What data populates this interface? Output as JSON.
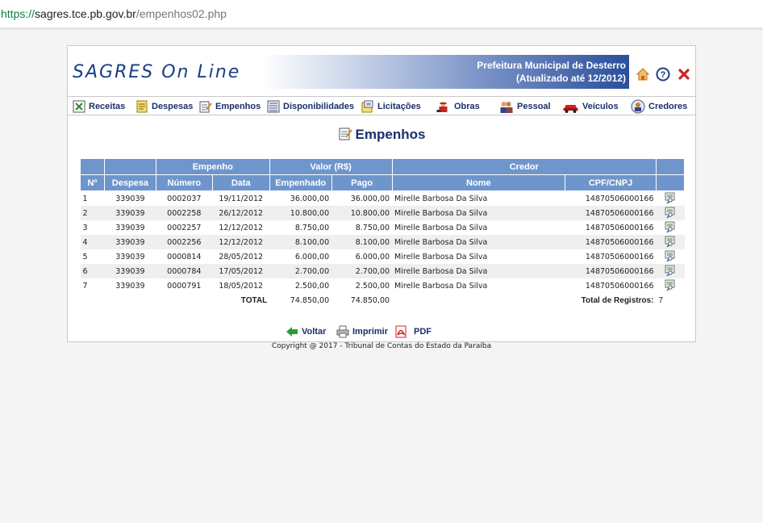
{
  "browser": {
    "url_scheme": "https://",
    "url_host": "sagres.tce.pb.gov.br",
    "url_path": "/empenhos02.php"
  },
  "header": {
    "logo": "SAGRES On Line",
    "entity": "Prefeitura Municipal de Desterro",
    "updated": "(Atualizado até 12/2012)"
  },
  "menu": {
    "receitas": "Receitas",
    "despesas": "Despesas",
    "empenhos": "Empenhos",
    "disponibilidades": "Disponibilidades",
    "licitacoes": "Licitações",
    "obras": "Obras",
    "pessoal": "Pessoal",
    "veiculos": "Veículos",
    "credores": "Credores"
  },
  "page": {
    "title": "Empenhos"
  },
  "table": {
    "group_headers": {
      "empenho": "Empenho",
      "valor": "Valor (R$)",
      "credor": "Credor"
    },
    "headers": {
      "n": "Nº",
      "despesa": "Despesa",
      "numero": "Número",
      "data": "Data",
      "empenhado": "Empenhado",
      "pago": "Pago",
      "nome": "Nome",
      "cpf": "CPF/CNPJ"
    },
    "rows": [
      {
        "n": "1",
        "despesa": "339039",
        "numero": "0002037",
        "data": "19/11/2012",
        "empenhado": "36.000,00",
        "pago": "36.000,00",
        "nome": "Mirelle Barbosa Da Silva",
        "cpf": "14870506000166"
      },
      {
        "n": "2",
        "despesa": "339039",
        "numero": "0002258",
        "data": "26/12/2012",
        "empenhado": "10.800,00",
        "pago": "10.800,00",
        "nome": "Mirelle Barbosa Da Silva",
        "cpf": "14870506000166"
      },
      {
        "n": "3",
        "despesa": "339039",
        "numero": "0002257",
        "data": "12/12/2012",
        "empenhado": "8.750,00",
        "pago": "8.750,00",
        "nome": "Mirelle Barbosa Da Silva",
        "cpf": "14870506000166"
      },
      {
        "n": "4",
        "despesa": "339039",
        "numero": "0002256",
        "data": "12/12/2012",
        "empenhado": "8.100,00",
        "pago": "8.100,00",
        "nome": "Mirelle Barbosa Da Silva",
        "cpf": "14870506000166"
      },
      {
        "n": "5",
        "despesa": "339039",
        "numero": "0000814",
        "data": "28/05/2012",
        "empenhado": "6.000,00",
        "pago": "6.000,00",
        "nome": "Mirelle Barbosa Da Silva",
        "cpf": "14870506000166"
      },
      {
        "n": "6",
        "despesa": "339039",
        "numero": "0000784",
        "data": "17/05/2012",
        "empenhado": "2.700,00",
        "pago": "2.700,00",
        "nome": "Mirelle Barbosa Da Silva",
        "cpf": "14870506000166"
      },
      {
        "n": "7",
        "despesa": "339039",
        "numero": "0000791",
        "data": "18/05/2012",
        "empenhado": "2.500,00",
        "pago": "2.500,00",
        "nome": "Mirelle Barbosa Da Silva",
        "cpf": "14870506000166"
      }
    ],
    "total_label": "TOTAL",
    "total_empenhado": "74.850,00",
    "total_pago": "74.850,00",
    "total_registros_label": "Total de Registros:",
    "total_registros": "7"
  },
  "actions": {
    "voltar": "Voltar",
    "imprimir": "Imprimir",
    "pdf": "PDF"
  },
  "footer": {
    "copyright": "Copyright @ 2017 - Tribunal de Contas do Estado da Paraíba"
  },
  "colors": {
    "header_blue": "#6e96cc",
    "text_navy": "#1a2f6a",
    "close_red": "#cc2222"
  },
  "icons": {
    "home": "home-icon",
    "help": "help-icon",
    "close": "close-icon",
    "row_detail": "document-magnifier-icon"
  }
}
